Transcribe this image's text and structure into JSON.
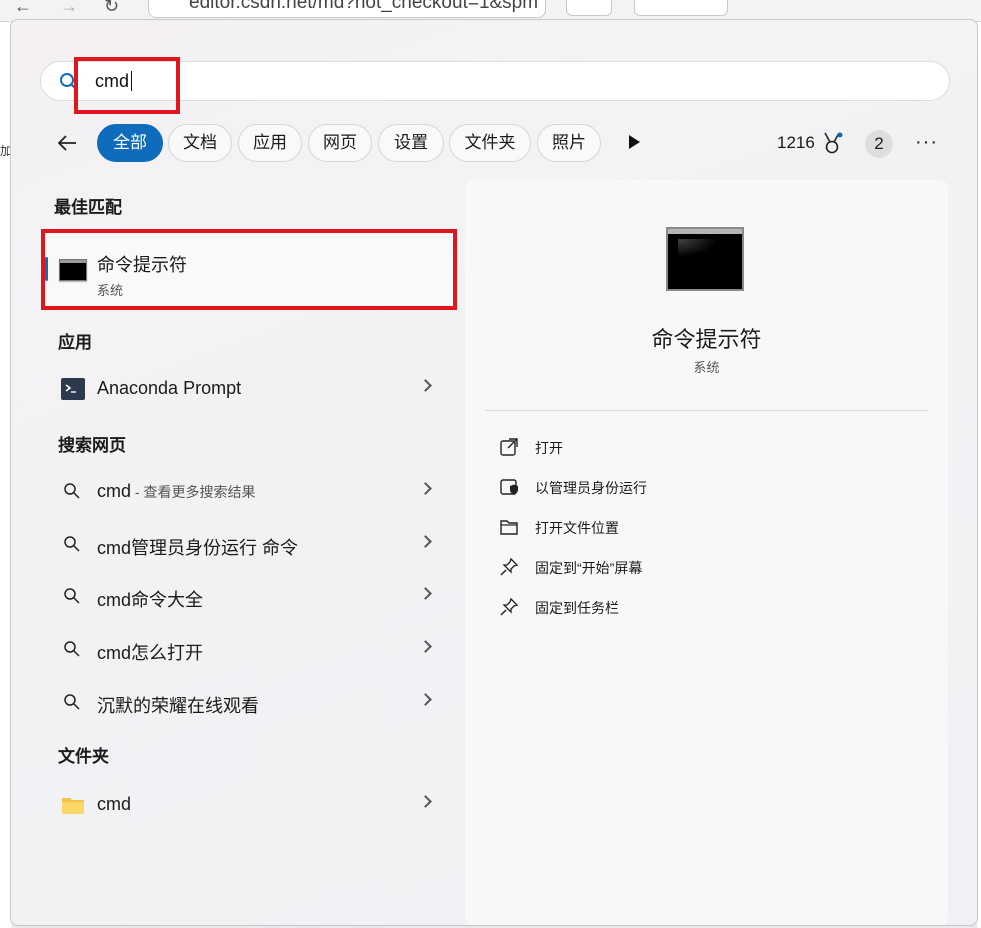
{
  "browser": {
    "url": "editor.csdn.net/md?not_checkout=1&spm",
    "left_edge_text": "加"
  },
  "search": {
    "value": "cmd"
  },
  "filters": {
    "tabs": [
      "全部",
      "文档",
      "应用",
      "网页",
      "设置",
      "文件夹",
      "照片"
    ],
    "active_index": 0,
    "points": "1216",
    "badge": "2",
    "more": "···"
  },
  "best_match": {
    "section": "最佳匹配",
    "title": "命令提示符",
    "subtitle": "系统"
  },
  "apps": {
    "section": "应用",
    "items": [
      {
        "label": "Anaconda Prompt"
      }
    ]
  },
  "web": {
    "section": "搜索网页",
    "first": {
      "label": "cmd",
      "hint": " - 查看更多搜索结果"
    },
    "items": [
      {
        "label": "cmd管理员身份运行 命令"
      },
      {
        "label": "cmd命令大全"
      },
      {
        "label": "cmd怎么打开"
      },
      {
        "label": "沉默的荣耀在线观看"
      }
    ]
  },
  "folders": {
    "section": "文件夹",
    "items": [
      {
        "label": "cmd"
      }
    ]
  },
  "preview": {
    "title": "命令提示符",
    "subtitle": "系统",
    "actions": [
      {
        "label": "打开",
        "icon": "open-external-icon"
      },
      {
        "label": "以管理员身份运行",
        "icon": "admin-shield-icon"
      },
      {
        "label": "打开文件位置",
        "icon": "folder-open-icon"
      },
      {
        "label": "固定到“开始”屏幕",
        "icon": "pin-icon"
      },
      {
        "label": "固定到任务栏",
        "icon": "pin-icon"
      }
    ]
  },
  "colors": {
    "accent": "#0f6cbd",
    "highlight_box": "#e0161d"
  }
}
